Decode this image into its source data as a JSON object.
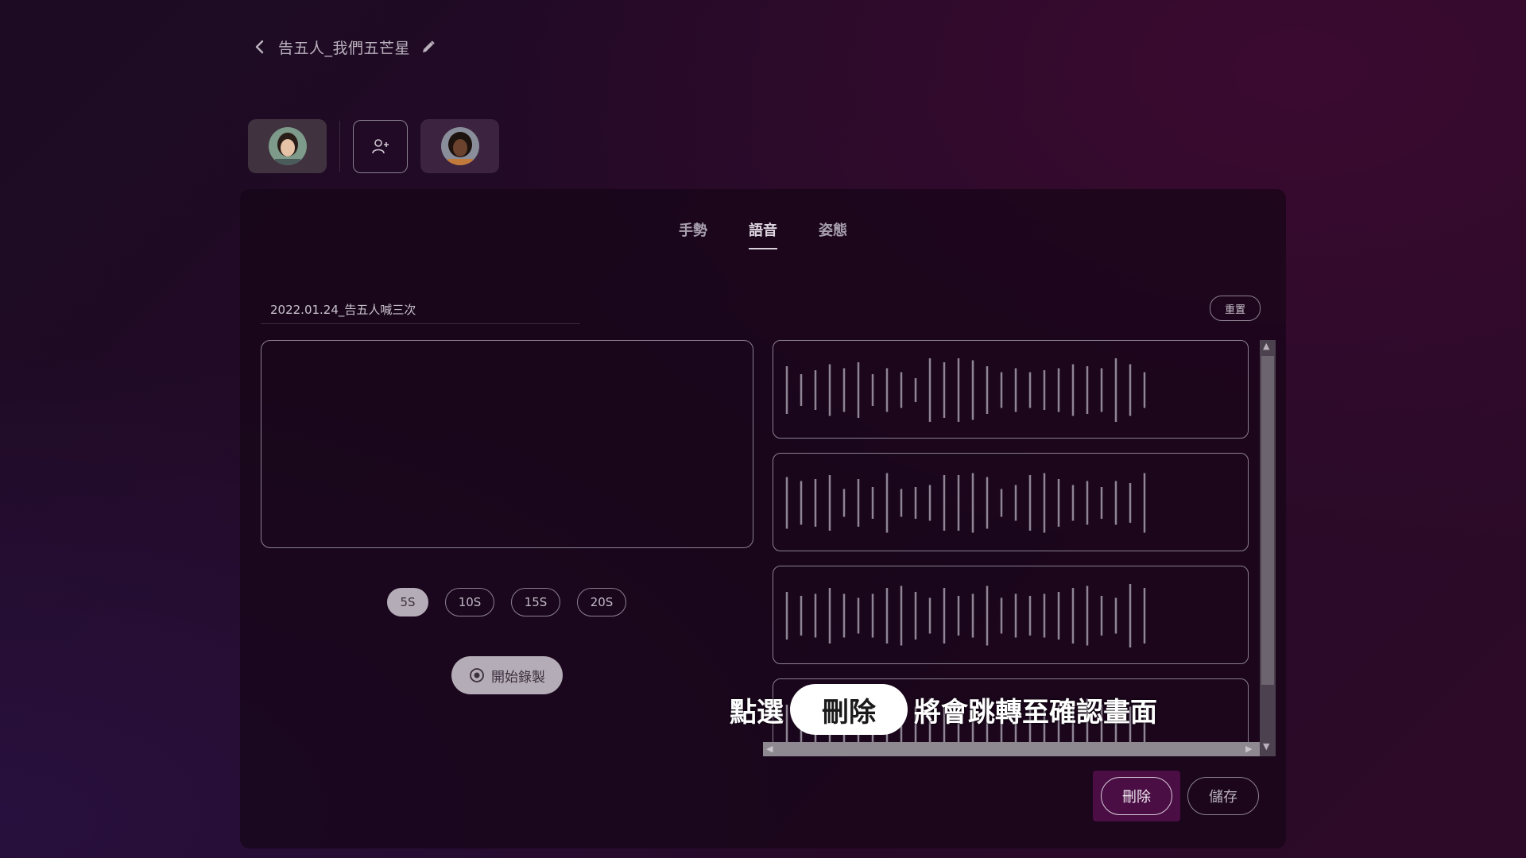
{
  "header": {
    "back_icon": "chevron-left-icon",
    "title": "告五人_我們五芒星",
    "edit_icon": "pencil-icon"
  },
  "avatars": {
    "items": [
      {
        "name": "avatar-1",
        "selected": true
      },
      {
        "name": "avatar-2",
        "selected": false
      }
    ],
    "add_icon": "add-user-icon"
  },
  "tabs": [
    {
      "label": "手勢",
      "active": false
    },
    {
      "label": "語音",
      "active": true
    },
    {
      "label": "姿態",
      "active": false
    }
  ],
  "recording": {
    "name_value": "2022.01.24_告五人喊三次",
    "reset_label": "重置",
    "durations": [
      {
        "label": "5S",
        "active": true
      },
      {
        "label": "10S",
        "active": false
      },
      {
        "label": "15S",
        "active": false
      },
      {
        "label": "20S",
        "active": false
      }
    ],
    "start_label": "開始錄製",
    "start_icon": "record-icon"
  },
  "waveforms": {
    "count": 4,
    "color": "#8f8595"
  },
  "actions": {
    "delete_label": "刪除",
    "save_label": "儲存"
  },
  "caption": {
    "prefix": "點選",
    "highlight": "刪除",
    "suffix": "將會跳轉至確認畫面"
  },
  "colors": {
    "accent": "#4a0e45",
    "panel": "#160618"
  }
}
